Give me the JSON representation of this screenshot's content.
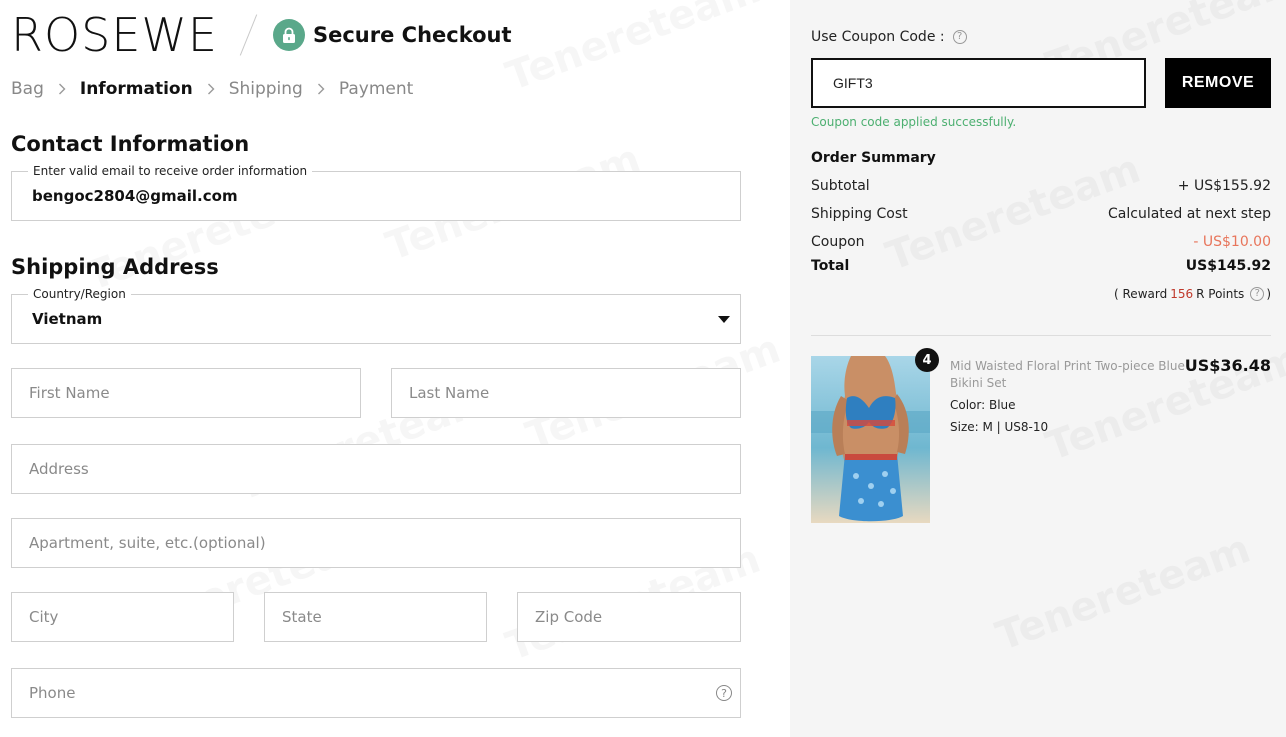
{
  "header": {
    "logo": "ROSEWE",
    "secure_label": "Secure Checkout"
  },
  "breadcrumb": {
    "items": [
      "Bag",
      "Information",
      "Shipping",
      "Payment"
    ],
    "active": "Information"
  },
  "contact": {
    "title": "Contact Information",
    "email_legend": "Enter valid email to receive order information",
    "email_value": "bengoc2804@gmail.com"
  },
  "shipping": {
    "title": "Shipping Address",
    "country_legend": "Country/Region",
    "country_value": "Vietnam",
    "first_name_ph": "First Name",
    "last_name_ph": "Last Name",
    "address_ph": "Address",
    "apartment_ph": "Apartment, suite, etc.(optional)",
    "city_ph": "City",
    "state_ph": "State",
    "zip_ph": "Zip Code",
    "phone_ph": "Phone"
  },
  "coupon": {
    "label": "Use Coupon Code :",
    "value": "GIFT3",
    "remove_label": "REMOVE",
    "success_msg": "Coupon code applied successfully."
  },
  "summary": {
    "title": "Order Summary",
    "subtotal_label": "Subtotal",
    "subtotal_value": "+ US$155.92",
    "shipping_label": "Shipping Cost",
    "shipping_value": "Calculated at next step",
    "coupon_label": "Coupon",
    "coupon_value": "- US$10.00",
    "total_label": "Total",
    "total_value": "US$145.92",
    "reward_prefix": "( Reward",
    "reward_points": "156",
    "reward_suffix": "R Points",
    "reward_close": ")"
  },
  "product": {
    "qty": "4",
    "name": "Mid Waisted Floral Print Two-piece Blue Bikini Set",
    "price": "US$36.48",
    "color": "Color: Blue",
    "size": "Size: M | US8-10"
  },
  "colors": {
    "secure_badge": "#5aa88a",
    "success": "#4caf70",
    "discount": "#e8755b",
    "reward_points": "#c0392b",
    "sidebar_bg": "#f5f5f5"
  },
  "icons": {
    "lock": "lock-icon",
    "help": "question-circle-icon",
    "chevron": "chevron-right-icon",
    "dropdown": "caret-down-icon"
  }
}
